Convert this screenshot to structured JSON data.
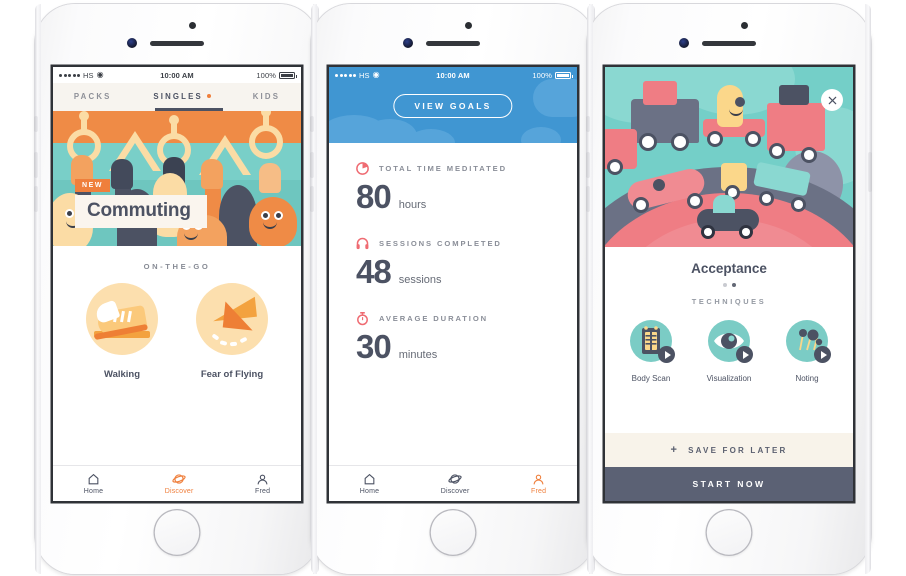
{
  "status_bar": {
    "carrier": "HS",
    "signal_dots": 5,
    "wifi_icon": "wifi-icon",
    "time": "10:00 AM",
    "battery_percent": "100%"
  },
  "colors": {
    "orange": "#ef7f3c",
    "teal": "#74cfc8",
    "slate": "#4c5263",
    "blue": "#4096d2",
    "cream": "#f8f3ea",
    "coral": "#ef6b72",
    "sand": "#fcdfae"
  },
  "phone1": {
    "top_tabs": [
      {
        "label": "PACKS",
        "active": false
      },
      {
        "label": "SINGLES",
        "active": true,
        "has_dot": true
      },
      {
        "label": "KIDS",
        "active": false
      }
    ],
    "hero": {
      "badge": "NEW",
      "title": "Commuting"
    },
    "section_label": "ON-THE-GO",
    "cards": [
      {
        "label": "Walking",
        "icon": "shoe-icon"
      },
      {
        "label": "Fear of Flying",
        "icon": "paper-plane-icon"
      }
    ],
    "tab_bar": [
      {
        "label": "Home",
        "icon": "home-icon",
        "active": false
      },
      {
        "label": "Discover",
        "icon": "planet-icon",
        "active": true
      },
      {
        "label": "Fred",
        "icon": "person-icon",
        "active": false
      }
    ]
  },
  "phone2": {
    "header_button": "VIEW GOALS",
    "stats": [
      {
        "label": "TOTAL TIME MEDITATED",
        "value": "80",
        "unit": "hours",
        "icon": "pie-chart-icon"
      },
      {
        "label": "SESSIONS COMPLETED",
        "value": "48",
        "unit": "sessions",
        "icon": "headphones-icon"
      },
      {
        "label": "AVERAGE DURATION",
        "value": "30",
        "unit": "minutes",
        "icon": "stopwatch-icon"
      }
    ],
    "tab_bar": [
      {
        "label": "Home",
        "icon": "home-icon",
        "active": false
      },
      {
        "label": "Discover",
        "icon": "planet-icon",
        "active": false
      },
      {
        "label": "Fred",
        "icon": "person-icon",
        "active": true
      }
    ]
  },
  "phone3": {
    "close_icon": "close-icon",
    "title": "Acceptance",
    "page_dots": {
      "count": 2,
      "active_index": 1
    },
    "subtitle": "TECHNIQUES",
    "techniques": [
      {
        "label": "Body Scan",
        "icon": "body-scan-icon"
      },
      {
        "label": "Visualization",
        "icon": "eye-icon"
      },
      {
        "label": "Noting",
        "icon": "noting-icon"
      }
    ],
    "save_label": "SAVE FOR LATER",
    "save_plus": "+",
    "start_label": "START NOW"
  }
}
